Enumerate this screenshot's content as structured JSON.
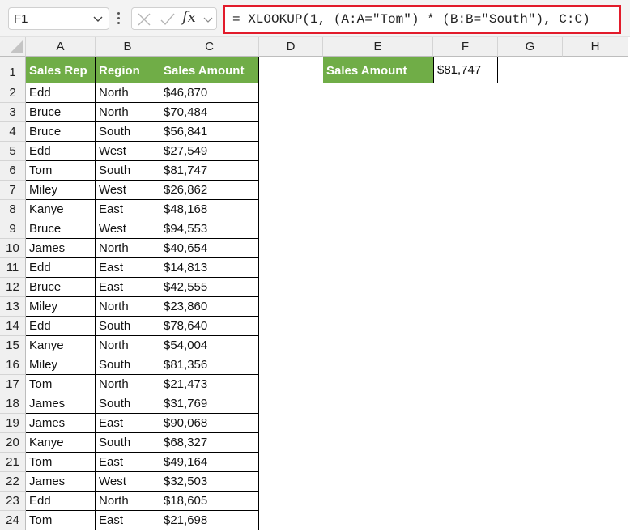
{
  "formula_bar": {
    "name_box": "F1",
    "formula": "= XLOOKUP(1, (A:A=\"Tom\") * (B:B=\"South\"), C:C)",
    "fx_label": "fx",
    "highlight_color": "#e21b2b"
  },
  "columns": [
    "A",
    "B",
    "C",
    "D",
    "E",
    "F",
    "G",
    "H"
  ],
  "table": {
    "header_color": "#70ad47",
    "headers": [
      "Sales Rep",
      "Region",
      "Sales Amount"
    ],
    "rows": [
      [
        "Edd",
        "North",
        "$46,870"
      ],
      [
        "Bruce",
        "North",
        "$70,484"
      ],
      [
        "Bruce",
        "South",
        "$56,841"
      ],
      [
        "Edd",
        "West",
        "$27,549"
      ],
      [
        "Tom",
        "South",
        "$81,747"
      ],
      [
        "Miley",
        "West",
        "$26,862"
      ],
      [
        "Kanye",
        "East",
        "$48,168"
      ],
      [
        "Bruce",
        "West",
        "$94,553"
      ],
      [
        "James",
        "North",
        "$40,654"
      ],
      [
        "Edd",
        "East",
        "$14,813"
      ],
      [
        "Bruce",
        "East",
        "$42,555"
      ],
      [
        "Miley",
        "North",
        "$23,860"
      ],
      [
        "Edd",
        "South",
        "$78,640"
      ],
      [
        "Kanye",
        "North",
        "$54,004"
      ],
      [
        "Miley",
        "South",
        "$81,356"
      ],
      [
        "Tom",
        "North",
        "$21,473"
      ],
      [
        "James",
        "South",
        "$31,769"
      ],
      [
        "James",
        "East",
        "$90,068"
      ],
      [
        "Kanye",
        "South",
        "$68,327"
      ],
      [
        "Tom",
        "East",
        "$49,164"
      ],
      [
        "James",
        "West",
        "$32,503"
      ],
      [
        "Edd",
        "North",
        "$18,605"
      ],
      [
        "Tom",
        "East",
        "$21,698"
      ]
    ]
  },
  "lookup": {
    "label": "Sales Amount",
    "result": "$81,747"
  },
  "row_numbers": [
    "1",
    "2",
    "3",
    "4",
    "5",
    "6",
    "7",
    "8",
    "9",
    "10",
    "11",
    "12",
    "13",
    "14",
    "15",
    "16",
    "17",
    "18",
    "19",
    "20",
    "21",
    "22",
    "23",
    "24"
  ]
}
